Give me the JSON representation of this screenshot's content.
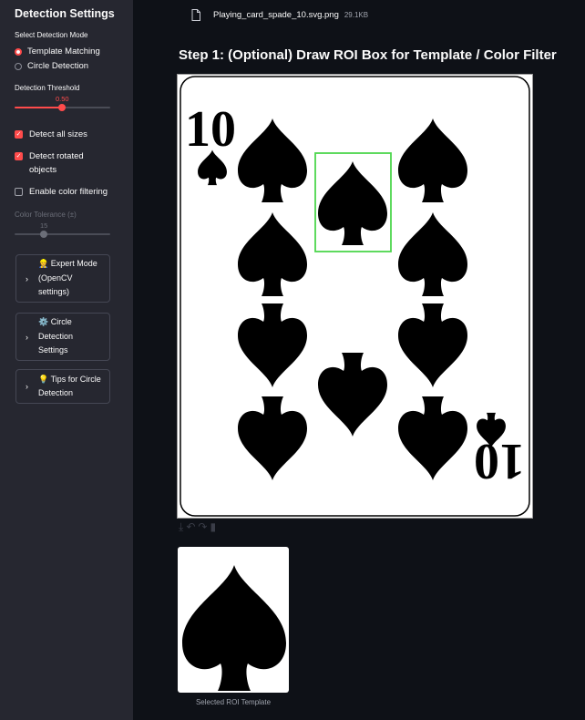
{
  "sidebar": {
    "title": "Detection Settings",
    "mode_label": "Select Detection Mode",
    "modes": [
      {
        "label": "Template Matching",
        "selected": true
      },
      {
        "label": "Circle Detection",
        "selected": false
      }
    ],
    "threshold": {
      "label": "Detection Threshold",
      "value": "0.50",
      "fraction": 0.5
    },
    "checkboxes": [
      {
        "label": "Detect all sizes",
        "checked": true
      },
      {
        "label": "Detect rotated objects",
        "checked": true
      },
      {
        "label": "Enable color filtering",
        "checked": false
      }
    ],
    "color_tolerance": {
      "label": "Color Tolerance (±)",
      "value": "15",
      "fraction": 0.3
    },
    "expanders": [
      {
        "icon": "👷",
        "icon_name": "worker-icon",
        "label": "Expert Mode (OpenCV settings)"
      },
      {
        "icon": "⚙️",
        "icon_name": "gear-icon",
        "label": "Circle Detection Settings"
      },
      {
        "icon": "💡",
        "icon_name": "lightbulb-icon",
        "label": "Tips for Circle Detection"
      }
    ]
  },
  "main": {
    "file": {
      "name": "Playing_card_spade_10.svg.png",
      "size": "29.1KB"
    },
    "step_title": "Step 1: (Optional) Draw ROI Box for Template / Color Filter",
    "card": {
      "rank": "10",
      "suit": "spade"
    },
    "thumbnail_caption": "Selected ROI Template"
  },
  "colors": {
    "accent": "#ff4b4b",
    "roi_box": "#4cd64c",
    "sidebar_bg": "#262730",
    "main_bg": "#0e1117"
  }
}
